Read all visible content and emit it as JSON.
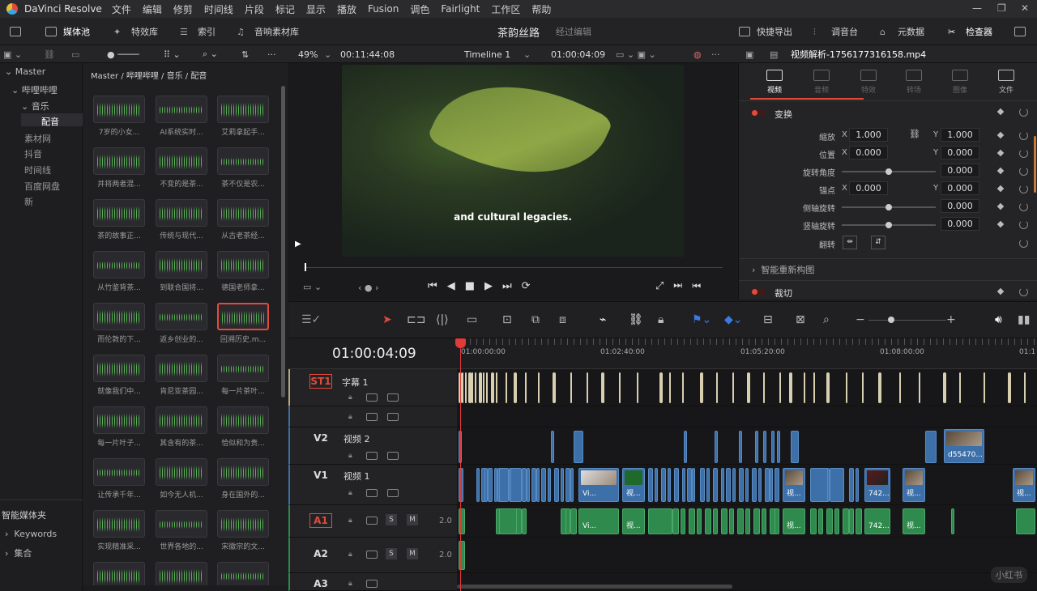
{
  "menubar": {
    "app_name": "DaVinci Resolve",
    "items": [
      "文件",
      "编辑",
      "修剪",
      "时间线",
      "片段",
      "标记",
      "显示",
      "播放",
      "Fusion",
      "调色",
      "Fairlight",
      "工作区",
      "帮助"
    ]
  },
  "toolbar": {
    "media_pool": "媒体池",
    "effects": "特效库",
    "index": "索引",
    "sound_library": "音响素材库",
    "project_name": "茶韵丝路",
    "project_status": "经过编辑",
    "quick_export": "快捷导出",
    "mixer": "调音台",
    "metadata": "元数据",
    "inspector": "检查器"
  },
  "viewer_bar": {
    "zoom": "49%",
    "source_tc": "00:11:44:08",
    "timeline_name": "Timeline 1",
    "record_tc": "01:00:04:09"
  },
  "inspector_title": "视频解析-1756177316158.mp4",
  "left_panel": {
    "master": "Master",
    "folder1": "哔哩哔哩",
    "folder2": "音乐",
    "folder3": "配音",
    "items": [
      "素材网",
      "抖音",
      "时间线",
      "百度网盘",
      "新"
    ],
    "smart_bins": "智能媒体夹",
    "keywords": "Keywords",
    "collections": "集合"
  },
  "media_pool": {
    "breadcrumb": "Master / 哔哩哔哩 / 音乐 / 配音",
    "clips": [
      "7岁的小女...",
      "AI系统实时...",
      "艾莉拿起手...",
      "并将两者混...",
      "不变的是茶...",
      "茶不仅是农...",
      "茶的故事正...",
      "传统与现代...",
      "从古老茶经...",
      "从竹鉴背茶...",
      "到联合国将...",
      "德国老师拿...",
      "而伦敦的下...",
      "返乡创业的...",
      "回溯历史.m...",
      "就像我们中...",
      "肯尼亚茶园...",
      "每一片茶叶...",
      "每一片叶子...",
      "其含有的茶...",
      "恰似和为贵...",
      "让传承千年...",
      "如今无人机...",
      "身在国外的...",
      "实现精准采...",
      "世界各地的...",
      "宋徽宗的文...",
      "",
      "",
      ""
    ]
  },
  "viewer": {
    "subtitle": "and cultural legacies."
  },
  "inspector": {
    "tabs": [
      "视频",
      "音频",
      "特效",
      "转场",
      "图像",
      "文件"
    ],
    "section_transform": "变换",
    "zoom_label": "缩放",
    "zoom_x": "1.000",
    "zoom_y": "1.000",
    "position_label": "位置",
    "pos_x": "0.000",
    "pos_y": "0.000",
    "rotation_label": "旋转角度",
    "rotation": "0.000",
    "anchor_label": "锚点",
    "anchor_x": "0.000",
    "anchor_y": "0.000",
    "pitch_label": "侧轴旋转",
    "pitch": "0.000",
    "yaw_label": "竖轴旋转",
    "yaw": "0.000",
    "flip_label": "翻转",
    "smart_reframe": "智能重新构图",
    "section_crop": "裁切",
    "x_axis": "X",
    "y_axis": "Y"
  },
  "timeline": {
    "timecode": "01:00:04:09",
    "ruler": [
      "01:00:00:00",
      "01:02:40:00",
      "01:05:20:00",
      "01:08:00:00",
      "01:1"
    ],
    "tracks": {
      "st1_id": "ST1",
      "st1_name": "字幕 1",
      "v2_id": "V2",
      "v2_name": "视频 2",
      "v1_id": "V1",
      "v1_name": "视频 1",
      "a1_id": "A1",
      "a1_level": "2.0",
      "a2_id": "A2",
      "a2_level": "2.0",
      "a3_id": "A3"
    },
    "clip_labels": {
      "v2_big": "d55470...",
      "v1_a": "Vi...",
      "v1_b": "视...",
      "v1_c": "视...",
      "v1_d": "742...",
      "v1_e": "视...",
      "v1_f": "视...",
      "a1_a": "Vi...",
      "a1_b": "视...",
      "a1_c": "视...",
      "a1_d": "742...",
      "a1_e": "视..."
    },
    "solo": "S",
    "mute": "M"
  },
  "watermark": "小红书",
  "colors": {
    "accent_red": "#e24a3a",
    "video_clip": "#3d6fa8",
    "audio_clip": "#2f8a4e",
    "subtitle_clip": "#d8cfb0"
  }
}
